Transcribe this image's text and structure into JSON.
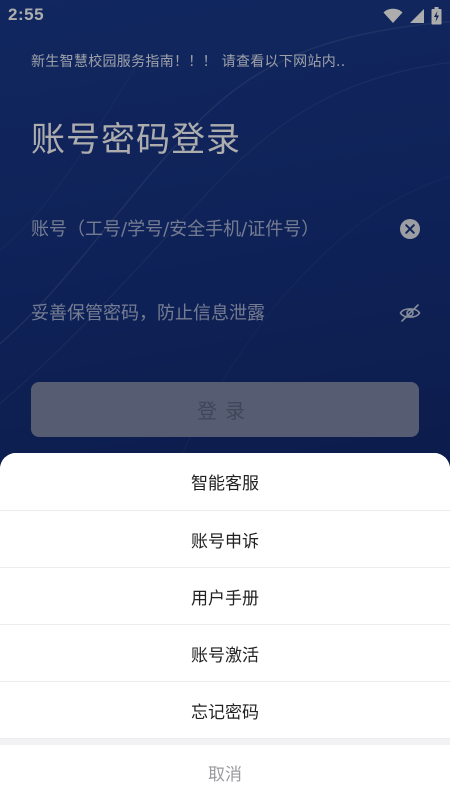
{
  "status_bar": {
    "time": "2:55",
    "icons": [
      "wifi-icon",
      "cell-signal-icon",
      "battery-charging-icon"
    ]
  },
  "page": {
    "notice": "新生智慧校园服务指南！！！ 请查看以下网站内..",
    "title": "账号密码登录",
    "account_field": {
      "placeholder": "账号（工号/学号/安全手机/证件号）",
      "value": "",
      "clear_icon": "clear-icon"
    },
    "password_field": {
      "placeholder": "妥善保管密码，防止信息泄露",
      "value": "",
      "visibility_icon": "eye-off-icon"
    },
    "login_label": "登录"
  },
  "action_sheet": {
    "items": [
      {
        "label": "智能客服"
      },
      {
        "label": "账号申诉"
      },
      {
        "label": "用户手册"
      },
      {
        "label": "账号激活"
      },
      {
        "label": "忘记密码"
      }
    ],
    "cancel_label": "取消"
  },
  "colors": {
    "background": "#163281",
    "login_button": "#7f88a8",
    "sheet_background": "#ffffff",
    "cancel_text": "#9a9a9e"
  }
}
